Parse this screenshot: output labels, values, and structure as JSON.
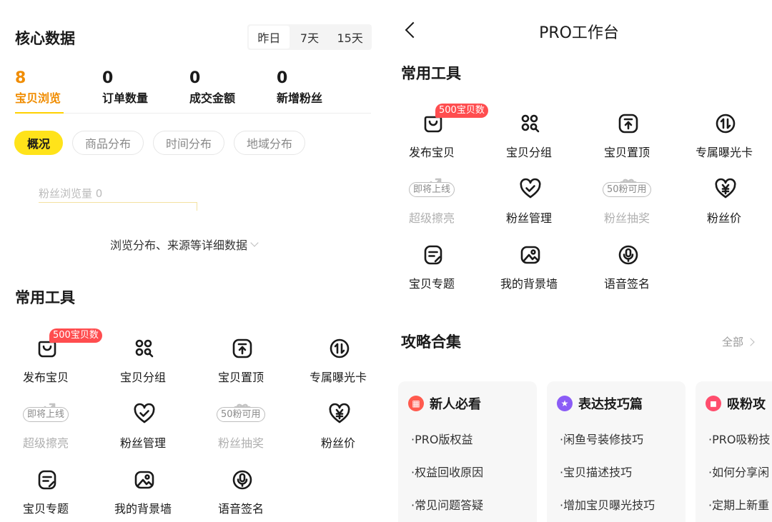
{
  "left": {
    "core_title": "核心数据",
    "range_tabs": [
      "昨日",
      "7天",
      "15天"
    ],
    "stats": [
      {
        "value": "8",
        "label": "宝贝浏览"
      },
      {
        "value": "0",
        "label": "订单数量"
      },
      {
        "value": "0",
        "label": "成交金额"
      },
      {
        "value": "0",
        "label": "新增粉丝"
      }
    ],
    "chips": [
      "概况",
      "商品分布",
      "时间分布",
      "地域分布"
    ],
    "chart_label": "粉丝浏览量 0",
    "detail_link": "浏览分布、来源等详细数据",
    "tools_title": "常用工具"
  },
  "tools": [
    {
      "label": "发布宝贝",
      "icon": "bag-icon",
      "badge": "500宝贝数"
    },
    {
      "label": "宝贝分组",
      "icon": "grid-search-icon"
    },
    {
      "label": "宝贝置顶",
      "icon": "pin-top-icon"
    },
    {
      "label": "专属曝光卡",
      "icon": "exposure-card-icon"
    },
    {
      "label": "超级擦亮",
      "icon": "polish-icon",
      "tag": "即将上线",
      "disabled": true
    },
    {
      "label": "粉丝管理",
      "icon": "heart-check-icon"
    },
    {
      "label": "粉丝抽奖",
      "icon": "gift-icon",
      "tag": "50粉可用",
      "disabled": true
    },
    {
      "label": "粉丝价",
      "icon": "heart-yen-icon"
    },
    {
      "label": "宝贝专题",
      "icon": "note-icon"
    },
    {
      "label": "我的背景墙",
      "icon": "image-icon"
    },
    {
      "label": "语音签名",
      "icon": "microphone-icon"
    }
  ],
  "right": {
    "page_title": "PRO工作台",
    "tools_title": "常用工具",
    "guides_title": "攻略合集",
    "all_link": "全部",
    "guides": [
      {
        "title": "新人必看",
        "color": "#ff5a4e",
        "items": [
          "·PRO版权益",
          "·权益回收原因",
          "·常见问题答疑"
        ]
      },
      {
        "title": "表达技巧篇",
        "color": "#8b5cf6",
        "items": [
          "·闲鱼号装修技巧",
          "·宝贝描述技巧",
          "·增加宝贝曝光技巧"
        ]
      },
      {
        "title": "吸粉攻",
        "color": "#ff4d6d",
        "items": [
          "·PRO吸粉技",
          "·如何分享闲",
          "·定期上新重"
        ]
      }
    ]
  },
  "colors": {
    "accent": "#ffe31a",
    "active_text": "#f08c00",
    "badge": "#ff4d4f"
  }
}
